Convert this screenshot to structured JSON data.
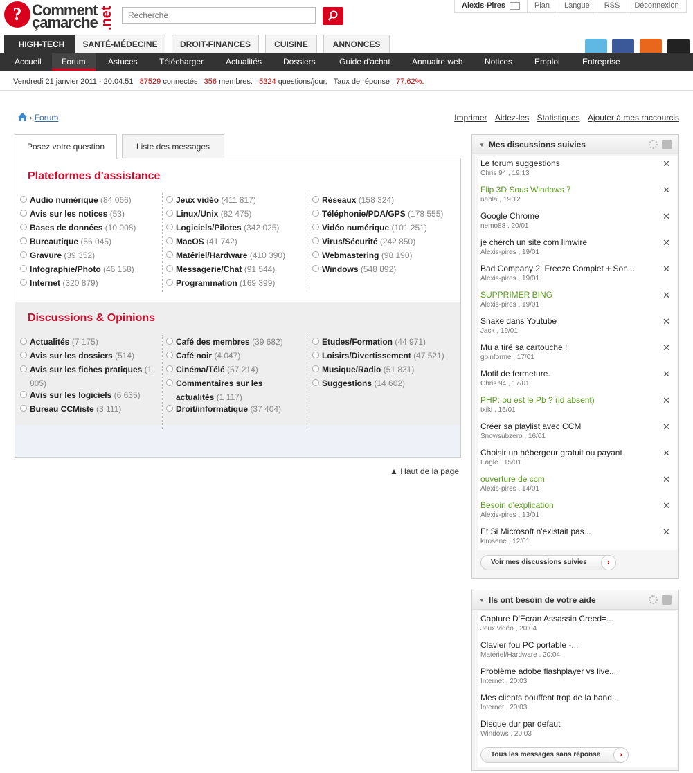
{
  "header": {
    "logo": {
      "line1": "Comment",
      "line2": "çamarche",
      "tld": ".net",
      "badge": "?"
    },
    "search_placeholder": "Recherche",
    "user_nav": [
      "Alexis-Pires",
      "Plan",
      "Langue",
      "RSS",
      "Déconnexion"
    ]
  },
  "category_tabs": [
    "HIGH-TECH",
    "SANTÉ-MÉDECINE",
    "DROIT-FINANCES",
    "CUISINE",
    "ANNONCES"
  ],
  "subnav": [
    "Accueil",
    "Forum",
    "Astuces",
    "Télécharger",
    "Actualités",
    "Dossiers",
    "Guide d'achat",
    "Annuaire web",
    "Notices",
    "Emploi",
    "Entreprise"
  ],
  "status": {
    "date": "Vendredi 21 janvier 2011 - 20:04:51",
    "connected_count": "87529",
    "connected_label": "connectés",
    "members_count": "356",
    "members_label": "membres.",
    "questions_count": "5324",
    "questions_label": "questions/jour,",
    "rate_label": "Taux de réponse :",
    "rate_value": "77,62%."
  },
  "breadcrumb": {
    "sep": "›",
    "current": "Forum"
  },
  "tools": [
    "Imprimer",
    "Aidez-les",
    "Statistiques",
    "Ajouter à mes raccourcis"
  ],
  "content_tabs": [
    "Posez votre question",
    "Liste des messages"
  ],
  "section1": {
    "title": "Plateformes d'assistance",
    "cols": [
      [
        [
          "Audio numérique",
          "(84 066)"
        ],
        [
          "Avis sur les notices",
          "(53)"
        ],
        [
          "Bases de données",
          "(10 008)"
        ],
        [
          "Bureautique",
          "(56 045)"
        ],
        [
          "Gravure",
          "(39 352)"
        ],
        [
          "Infographie/Photo",
          "(46 158)"
        ],
        [
          "Internet",
          "(320 879)"
        ]
      ],
      [
        [
          "Jeux vidéo",
          "(411 817)"
        ],
        [
          "Linux/Unix",
          "(82 475)"
        ],
        [
          "Logiciels/Pilotes",
          "(342 025)"
        ],
        [
          "MacOS",
          "(41 742)"
        ],
        [
          "Matériel/Hardware",
          "(410 390)"
        ],
        [
          "Messagerie/Chat",
          "(91 544)"
        ],
        [
          "Programmation",
          "(169 399)"
        ]
      ],
      [
        [
          "Réseaux",
          "(158 324)"
        ],
        [
          "Téléphonie/PDA/GPS",
          "(178 555)"
        ],
        [
          "Vidéo numérique",
          "(101 251)"
        ],
        [
          "Virus/Sécurité",
          "(242 850)"
        ],
        [
          "Webmastering",
          "(98 190)"
        ],
        [
          "Windows",
          "(548 892)"
        ]
      ]
    ]
  },
  "section2": {
    "title": "Discussions & Opinions",
    "col1": {
      "a": [
        "Actualités",
        "(7 175)"
      ],
      "b": [
        "Avis sur les dossiers",
        "(514)"
      ],
      "c_name": "Avis sur les fiches pratiques",
      "c_count_a": "(1",
      "c_count_b": "805)",
      "d": [
        "Avis sur les logiciels",
        "(6 635)"
      ],
      "e": [
        "Bureau CCMiste",
        "(3 111)"
      ]
    },
    "col2": {
      "a": [
        "Café des membres",
        "(39 682)"
      ],
      "b": [
        "Café noir",
        "(4 047)"
      ],
      "c": [
        "Cinéma/Télé",
        "(57 214)"
      ],
      "d_line1": "Commentaires sur les",
      "d_line2": "actualités",
      "d_count": "(1 117)",
      "e": [
        "Droit/informatique",
        "(37 404)"
      ]
    },
    "col3": [
      [
        "Etudes/Formation",
        "(44 971)"
      ],
      [
        "Loisirs/Divertissement",
        "(47 521)"
      ],
      [
        "Musique/Radio",
        "(51 831)"
      ],
      [
        "Suggestions",
        "(14 602)"
      ]
    ]
  },
  "haut_de_page": "Haut de la page",
  "panel1": {
    "title": "Mes discussions suivies",
    "close": "✕",
    "items": [
      {
        "title": "Le forum suggestions",
        "meta": "Chris 94 , 19:13",
        "green": false
      },
      {
        "title": "Flip 3D Sous Windows 7",
        "meta": "nabla , 19:12",
        "green": true
      },
      {
        "title": "Google Chrome",
        "meta": "nemo88 , 20/01",
        "green": false
      },
      {
        "title": "je cherch un site com limwire",
        "meta": "Alexis-pires , 19/01",
        "green": false
      },
      {
        "title": "Bad Company 2| Freeze Complet + Son...",
        "meta": "Alexis-pires , 19/01",
        "green": false
      },
      {
        "title": "SUPPRIMER BING",
        "meta": "Alexis-pires , 19/01",
        "green": true
      },
      {
        "title": "Snake dans Youtube",
        "meta": "Jack , 19/01",
        "green": false
      },
      {
        "title": "Mu a tiré sa cartouche !",
        "meta": "gbinforme , 17/01",
        "green": false
      },
      {
        "title": "Motif de fermeture.",
        "meta": "Chris 94 , 17/01",
        "green": false
      },
      {
        "title": "PHP: ou est le Pb ? (id absent)",
        "meta": "txiki , 16/01",
        "green": true
      },
      {
        "title": "Créer sa playlist avec CCM",
        "meta": "Snowsubzero , 16/01",
        "green": false
      },
      {
        "title": "Choisir un hébergeur gratuit ou payant",
        "meta": "Eagle , 15/01",
        "green": false
      },
      {
        "title": "ouverture de ccm",
        "meta": "Alexis-pires , 14/01",
        "green": true
      },
      {
        "title": "Besoin d'explication",
        "meta": "Alexis-pires , 13/01",
        "green": true
      },
      {
        "title": "Et Si Microsoft n'existait pas...",
        "meta": "kirosene , 12/01",
        "green": false
      }
    ],
    "button": "Voir mes discussions suivies"
  },
  "panel2": {
    "title": "Ils ont besoin de votre aide",
    "items": [
      {
        "title": "Capture D'Ecran Assassin Creed=...",
        "meta": "Jeux vidéo , 20:04"
      },
      {
        "title": "Clavier fou PC portable -...",
        "meta": "Matériel/Hardware , 20:04"
      },
      {
        "title": "Problème adobe flashplayer vs live...",
        "meta": "Internet , 20:03"
      },
      {
        "title": "Mes clients bouffent trop de la band...",
        "meta": "Internet , 20:03"
      },
      {
        "title": "Disque dur par defaut",
        "meta": "Windows , 20:03"
      }
    ],
    "button": "Tous les messages sans réponse"
  },
  "colors": {
    "brand_red": "#d9001d",
    "dark_nav": "#333333",
    "green_link": "#5a9c1d",
    "title_red": "#c8102e"
  }
}
